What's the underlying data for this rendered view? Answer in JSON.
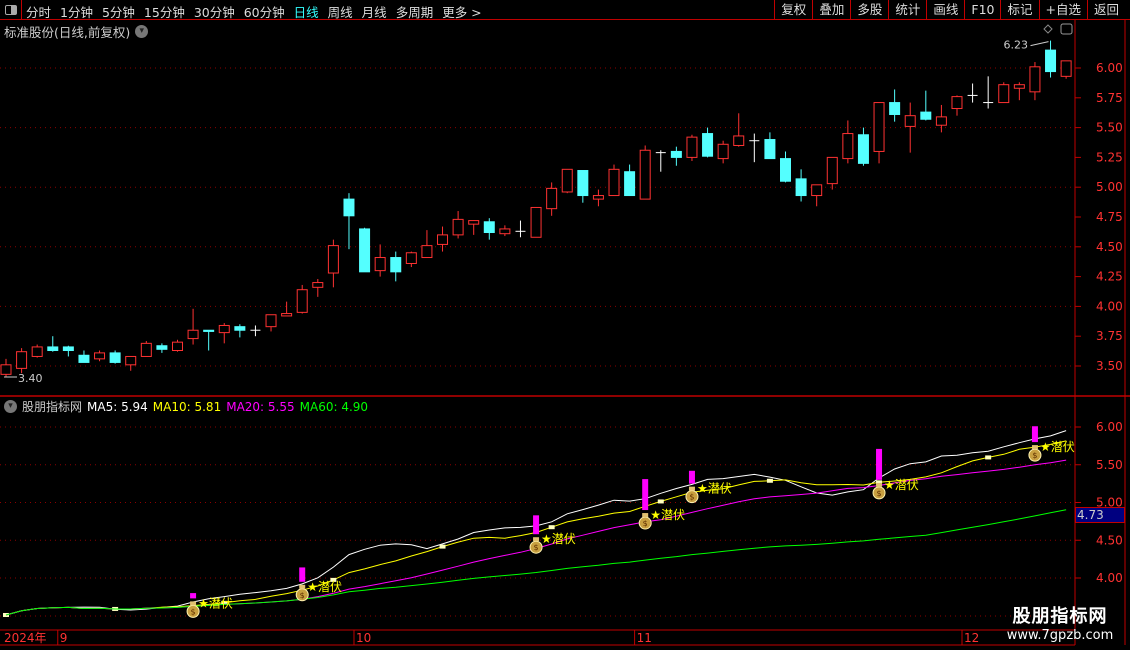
{
  "toolbar": {
    "periods": [
      "分时",
      "1分钟",
      "5分钟",
      "15分钟",
      "30分钟",
      "60分钟",
      "日线",
      "周线",
      "月线",
      "多周期",
      "更多 >"
    ],
    "active_period": "日线",
    "buttons": [
      "复权",
      "叠加",
      "多股",
      "统计",
      "画线",
      "F10",
      "标记",
      "+自选",
      "返回"
    ]
  },
  "main": {
    "title": "标准股份(日线,前复权)",
    "price_axis": [
      "6.00",
      "5.75",
      "5.50",
      "5.25",
      "5.00",
      "4.75",
      "4.50",
      "4.25",
      "4.00",
      "3.75",
      "3.50"
    ],
    "high_label": "6.23",
    "low_label": "3.40"
  },
  "indicator": {
    "name": "股朋指标网",
    "ma5": "MA5: 5.94",
    "ma10": "MA10: 5.81",
    "ma20": "MA20: 5.55",
    "ma60": "MA60: 4.90",
    "axis": [
      "6.00",
      "5.50",
      "5.00",
      "4.50",
      "4.00"
    ],
    "current_value": "4.73",
    "signal_label": "★潜伏"
  },
  "xaxis": {
    "year": "2024年",
    "months": [
      {
        "label": "9",
        "index": 3
      },
      {
        "label": "10",
        "index": 22
      },
      {
        "label": "11",
        "index": 40
      },
      {
        "label": "12",
        "index": 61
      }
    ]
  },
  "watermark": {
    "name": "股朋指标网",
    "url": "www.7gpzb.com"
  },
  "colors": {
    "up": "#ff3232",
    "down": "#54ffff",
    "flat": "#ffffff",
    "ma5": "#ffffff",
    "ma10": "#ffff00",
    "ma20": "#ff00ff",
    "ma60": "#00ff00",
    "signal": "#ff00ff",
    "axis": "#c00000",
    "grid": "#8b0000"
  },
  "chart_data": {
    "type": "candlestick",
    "fields": [
      "open",
      "high",
      "low",
      "close"
    ],
    "candles": [
      [
        3.43,
        3.56,
        3.41,
        3.51
      ],
      [
        3.48,
        3.65,
        3.44,
        3.62
      ],
      [
        3.58,
        3.68,
        3.57,
        3.66
      ],
      [
        3.66,
        3.75,
        3.62,
        3.63
      ],
      [
        3.66,
        3.67,
        3.58,
        3.63
      ],
      [
        3.59,
        3.63,
        3.53,
        3.53
      ],
      [
        3.56,
        3.63,
        3.54,
        3.61
      ],
      [
        3.61,
        3.63,
        3.52,
        3.53
      ],
      [
        3.51,
        3.58,
        3.46,
        3.58
      ],
      [
        3.58,
        3.71,
        3.58,
        3.69
      ],
      [
        3.67,
        3.69,
        3.61,
        3.64
      ],
      [
        3.63,
        3.72,
        3.62,
        3.7
      ],
      [
        3.73,
        3.98,
        3.68,
        3.8
      ],
      [
        3.8,
        3.8,
        3.63,
        3.79
      ],
      [
        3.78,
        3.86,
        3.69,
        3.84
      ],
      [
        3.83,
        3.85,
        3.74,
        3.8
      ],
      [
        3.8,
        3.84,
        3.75,
        3.8
      ],
      [
        3.83,
        3.93,
        3.79,
        3.93
      ],
      [
        3.92,
        4.04,
        3.92,
        3.94
      ],
      [
        3.95,
        4.18,
        3.94,
        4.14
      ],
      [
        4.16,
        4.23,
        4.08,
        4.2
      ],
      [
        4.28,
        4.56,
        4.16,
        4.51
      ],
      [
        4.9,
        4.95,
        4.48,
        4.76
      ],
      [
        4.65,
        4.66,
        4.29,
        4.29
      ],
      [
        4.3,
        4.52,
        4.25,
        4.41
      ],
      [
        4.41,
        4.46,
        4.21,
        4.29
      ],
      [
        4.36,
        4.46,
        4.33,
        4.45
      ],
      [
        4.41,
        4.64,
        4.41,
        4.51
      ],
      [
        4.52,
        4.67,
        4.46,
        4.6
      ],
      [
        4.6,
        4.8,
        4.57,
        4.73
      ],
      [
        4.69,
        4.72,
        4.6,
        4.72
      ],
      [
        4.71,
        4.74,
        4.56,
        4.62
      ],
      [
        4.61,
        4.68,
        4.59,
        4.65
      ],
      [
        4.63,
        4.72,
        4.58,
        4.63
      ],
      [
        4.58,
        4.83,
        4.58,
        4.83
      ],
      [
        4.82,
        5.04,
        4.76,
        4.99
      ],
      [
        4.96,
        5.15,
        4.95,
        5.15
      ],
      [
        5.14,
        5.14,
        4.87,
        4.93
      ],
      [
        4.9,
        4.98,
        4.84,
        4.93
      ],
      [
        4.93,
        5.19,
        4.93,
        5.15
      ],
      [
        5.13,
        5.19,
        4.93,
        4.93
      ],
      [
        4.9,
        5.35,
        4.9,
        5.31
      ],
      [
        5.29,
        5.31,
        5.13,
        5.29
      ],
      [
        5.3,
        5.34,
        5.18,
        5.25
      ],
      [
        5.25,
        5.44,
        5.22,
        5.42
      ],
      [
        5.45,
        5.5,
        5.25,
        5.26
      ],
      [
        5.24,
        5.39,
        5.2,
        5.36
      ],
      [
        5.35,
        5.62,
        5.34,
        5.43
      ],
      [
        5.39,
        5.45,
        5.21,
        5.39
      ],
      [
        5.4,
        5.46,
        5.24,
        5.24
      ],
      [
        5.24,
        5.3,
        5.04,
        5.05
      ],
      [
        5.07,
        5.15,
        4.88,
        4.93
      ],
      [
        4.93,
        5.02,
        4.84,
        5.02
      ],
      [
        5.03,
        5.25,
        4.98,
        5.25
      ],
      [
        5.24,
        5.56,
        5.2,
        5.45
      ],
      [
        5.44,
        5.5,
        5.18,
        5.2
      ],
      [
        5.3,
        5.71,
        5.2,
        5.71
      ],
      [
        5.71,
        5.82,
        5.55,
        5.61
      ],
      [
        5.51,
        5.71,
        5.29,
        5.6
      ],
      [
        5.63,
        5.81,
        5.56,
        5.57
      ],
      [
        5.52,
        5.69,
        5.46,
        5.59
      ],
      [
        5.66,
        5.77,
        5.6,
        5.76
      ],
      [
        5.77,
        5.87,
        5.71,
        5.77
      ],
      [
        5.71,
        5.93,
        5.66,
        5.71
      ],
      [
        5.71,
        5.88,
        5.71,
        5.86
      ],
      [
        5.83,
        5.88,
        5.73,
        5.86
      ],
      [
        5.8,
        6.05,
        5.73,
        6.01
      ],
      [
        6.15,
        6.23,
        5.92,
        5.97
      ],
      [
        5.93,
        6.06,
        5.91,
        6.06
      ]
    ],
    "signal_indices": [
      12,
      19,
      34,
      41,
      44,
      56,
      66
    ],
    "ma_periods": [
      5,
      10,
      20,
      60
    ],
    "main_ylim": [
      3.4,
      6.25
    ],
    "indicator_ylim": [
      3.5,
      6.3
    ],
    "grid": true
  }
}
